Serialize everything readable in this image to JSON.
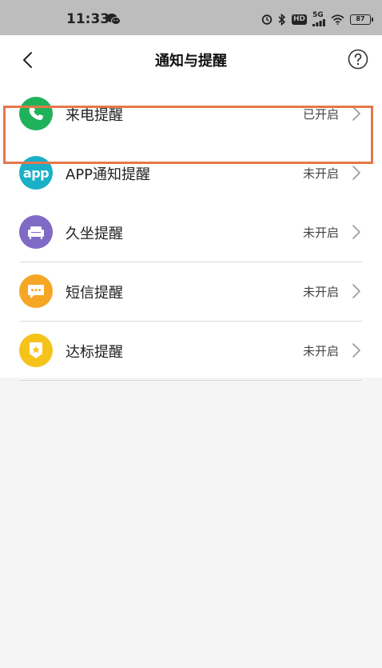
{
  "status_bar": {
    "time": "11:33",
    "network": "5G",
    "hd": "HD",
    "battery": "87"
  },
  "header": {
    "title": "通知与提醒"
  },
  "colors": {
    "call": "#1fb25a",
    "app": "#1ab0c8",
    "sedentary": "#7f6bc5",
    "sms": "#f5a623",
    "goal": "#f6c31a",
    "highlight": "#e5774b"
  },
  "reminders": [
    {
      "label": "来电提醒",
      "status": "已开启",
      "icon": "phone-icon"
    },
    {
      "label": "APP通知提醒",
      "status": "未开启",
      "icon": "app-icon",
      "icon_text": "app"
    },
    {
      "label": "久坐提醒",
      "status": "未开启",
      "icon": "sofa-icon"
    },
    {
      "label": "短信提醒",
      "status": "未开启",
      "icon": "message-icon"
    },
    {
      "label": "达标提醒",
      "status": "未开启",
      "icon": "star-badge-icon"
    }
  ]
}
